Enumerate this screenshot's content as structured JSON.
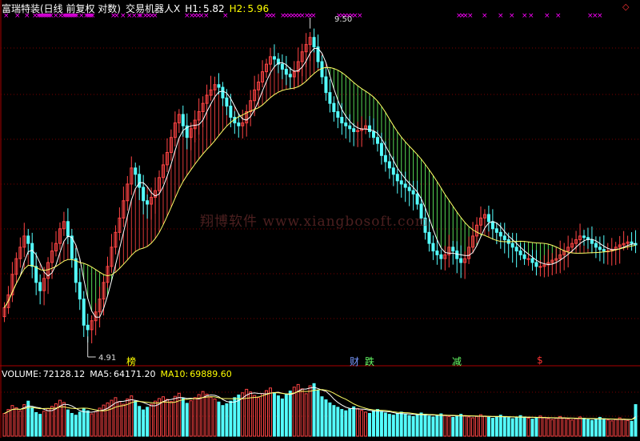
{
  "header": {
    "title": "富瑞特装(日线 前复权 对数)",
    "indicator": "交易机器人X",
    "h1_label": "H1:",
    "h1_value": "5.82",
    "h2_label": "H2:",
    "h2_value": "5.96"
  },
  "volume_header": {
    "vol_label": "VOLUME:",
    "vol_value": "72128.12",
    "ma5_label": "MA5:",
    "ma5_value": "64171.20",
    "ma10_label": "MA10:",
    "ma10_value": "69889.60"
  },
  "watermark": "翔博软件 www.xiangbosoft.com",
  "annotations": {
    "high": "9.50",
    "low": "4.91"
  },
  "events": [
    {
      "label": "榜",
      "color": "#ffff00"
    },
    {
      "label": "财",
      "color": "#7799ff"
    },
    {
      "label": "跌",
      "color": "#66ff66"
    },
    {
      "label": "减",
      "color": "#66ff66"
    },
    {
      "label": "$",
      "color": "#ff3333"
    }
  ],
  "top_controls": {
    "right_icon": "◇"
  },
  "colors": {
    "up": "#ff4444",
    "down": "#54ffff",
    "ma_short": "#ffffff",
    "ma_long": "#ffff66",
    "band_up": "#ff4444",
    "band_down": "#66ff66",
    "marker": "#ff00ff",
    "ma5": "#ffffff",
    "ma10": "#ffff66",
    "grid": "#7a0000",
    "axis": "#aa0000"
  },
  "chart_data": [
    {
      "type": "candlestick",
      "title": "富瑞特装(日线 前复权 对数)",
      "scale": "log",
      "ylim": [
        4.6,
        10.0
      ],
      "grid": true,
      "x": [
        1,
        2,
        3,
        4,
        5,
        6,
        7,
        8,
        9,
        10,
        11,
        12,
        13,
        14,
        15,
        16,
        17,
        18,
        19,
        20,
        21,
        22,
        23,
        24,
        25,
        26,
        27,
        28,
        29,
        30,
        31,
        32,
        33,
        34,
        35,
        36,
        37,
        38,
        39,
        40,
        41,
        42,
        43,
        44,
        45,
        46,
        47,
        48,
        49,
        50,
        51,
        52,
        53,
        54,
        55,
        56,
        57,
        58,
        59,
        60,
        61,
        62,
        63,
        64,
        65,
        66,
        67,
        68,
        69,
        70,
        71,
        72,
        73,
        74,
        75,
        76,
        77,
        78,
        79,
        80,
        81,
        82,
        83,
        84,
        85,
        86,
        87,
        88,
        89,
        90,
        91,
        92,
        93,
        94,
        95,
        96,
        97,
        98,
        99,
        100,
        101,
        102,
        103,
        104,
        105,
        106,
        107,
        108,
        109,
        110,
        111,
        112,
        113,
        114,
        115,
        116,
        117,
        118,
        119,
        120,
        121,
        122,
        123,
        124,
        125,
        126,
        127,
        128,
        129,
        130,
        131,
        132,
        133,
        134,
        135,
        136,
        137,
        138,
        139,
        140,
        141,
        142,
        143,
        144,
        145,
        146,
        147,
        148,
        149,
        150,
        151,
        152,
        153,
        154,
        155,
        156,
        157,
        158,
        159,
        160
      ],
      "close": [
        5.2,
        5.35,
        5.6,
        5.8,
        5.95,
        6.1,
        6.0,
        5.7,
        5.5,
        5.4,
        5.55,
        5.75,
        5.9,
        6.0,
        6.2,
        6.3,
        6.1,
        5.8,
        5.5,
        5.3,
        5.0,
        4.95,
        5.05,
        5.15,
        5.3,
        5.5,
        5.7,
        5.95,
        6.15,
        6.35,
        6.6,
        6.85,
        7.1,
        7.0,
        6.8,
        6.6,
        6.55,
        6.65,
        6.75,
        6.95,
        7.15,
        7.35,
        7.6,
        7.85,
        8.0,
        7.8,
        7.6,
        7.75,
        7.9,
        8.05,
        8.2,
        8.35,
        8.45,
        8.55,
        8.5,
        8.3,
        8.15,
        7.95,
        7.85,
        7.8,
        7.85,
        8.05,
        8.25,
        8.45,
        8.6,
        8.8,
        8.95,
        9.1,
        9.05,
        8.95,
        8.85,
        8.75,
        8.7,
        8.8,
        9.0,
        9.2,
        9.35,
        9.5,
        9.3,
        9.0,
        8.7,
        8.4,
        8.2,
        8.05,
        7.95,
        7.85,
        7.8,
        7.75,
        7.7,
        7.72,
        7.75,
        7.8,
        7.7,
        7.6,
        7.5,
        7.3,
        7.2,
        7.1,
        7.0,
        6.9,
        6.85,
        6.8,
        6.75,
        6.7,
        6.55,
        6.35,
        6.15,
        6.0,
        5.9,
        5.85,
        5.8,
        5.85,
        5.95,
        5.9,
        5.8,
        5.75,
        5.8,
        5.95,
        6.1,
        6.25,
        6.35,
        6.4,
        6.3,
        6.2,
        6.15,
        6.1,
        6.05,
        6.0,
        5.95,
        5.9,
        5.85,
        5.8,
        5.8,
        5.75,
        5.7,
        5.7,
        5.72,
        5.75,
        5.78,
        5.8,
        5.85,
        5.9,
        5.95,
        6.0,
        6.05,
        6.1,
        6.08,
        6.05,
        6.0,
        5.95,
        5.92,
        5.9,
        5.9,
        5.92,
        5.95,
        5.98,
        6.0,
        6.02,
        6.0,
        5.98
      ],
      "series": [
        {
          "name": "MA",
          "type": "line"
        },
        {
          "name": "MA-long",
          "type": "line"
        }
      ]
    },
    {
      "type": "bar",
      "title": "VOLUME",
      "categories": [],
      "values": [
        52000,
        61000,
        70000,
        65000,
        58000,
        72000,
        80000,
        66000,
        54000,
        50000,
        57000,
        63000,
        68000,
        74000,
        82000,
        77000,
        60000,
        52000,
        48000,
        55000,
        62000,
        58000,
        51000,
        56000,
        64000,
        71000,
        76000,
        82000,
        88000,
        79000,
        73000,
        85000,
        92000,
        80000,
        68000,
        60000,
        66000,
        73000,
        80000,
        86000,
        90000,
        84000,
        79000,
        91000,
        98000,
        87000,
        75000,
        81000,
        88000,
        95000,
        102000,
        96000,
        89000,
        85000,
        78000,
        70000,
        74000,
        80000,
        88000,
        94000,
        99000,
        107000,
        101000,
        93000,
        88000,
        97000,
        104000,
        110000,
        99000,
        92000,
        85000,
        96000,
        103000,
        112000,
        118000,
        108000,
        97000,
        115000,
        120000,
        104000,
        90000,
        83000,
        76000,
        70000,
        66000,
        61000,
        58000,
        62000,
        67000,
        63000,
        59000,
        55000,
        52000,
        58000,
        61000,
        57000,
        53000,
        50000,
        48000,
        52000,
        55000,
        51000,
        47000,
        45000,
        49000,
        53000,
        50000,
        46000,
        44000,
        47000,
        51000,
        48000,
        45000,
        43000,
        46000,
        50000,
        47000,
        44000,
        42000,
        45000,
        49000,
        46000,
        43000,
        41000,
        44000,
        48000,
        45000,
        42000,
        40000,
        43000,
        47000,
        44000,
        41000,
        39000,
        42000,
        46000,
        43000,
        40000,
        38000,
        41000,
        45000,
        42000,
        39000,
        37000,
        40000,
        44000,
        41000,
        38000,
        36000,
        39000,
        43000,
        40000,
        37000,
        35000,
        38000,
        42000,
        39000,
        36000,
        34000,
        72128
      ],
      "series": [
        {
          "name": "MA5",
          "type": "line"
        },
        {
          "name": "MA10",
          "type": "line"
        }
      ]
    }
  ]
}
